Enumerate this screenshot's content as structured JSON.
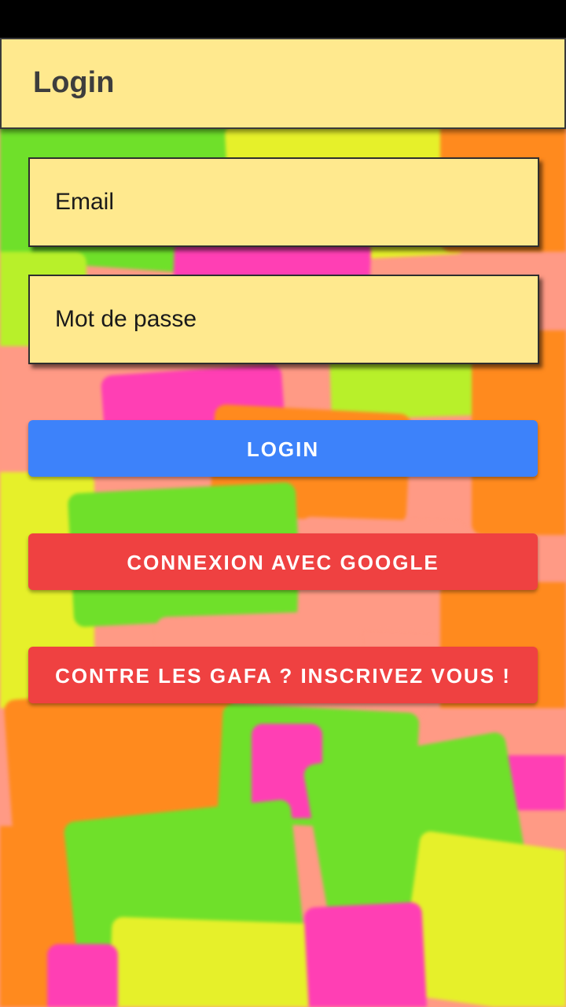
{
  "app_bar": {
    "title": "Login"
  },
  "form": {
    "email_placeholder": "Email",
    "password_placeholder": "Mot de passe"
  },
  "buttons": {
    "login": "LOGIN",
    "google": "CONNEXION AVEC GOOGLE",
    "register": "CONTRE LES GAFA ? INSCRIVEZ VOUS !"
  },
  "colors": {
    "app_bar_background": "#ffe98e",
    "field_background": "#ffe98e",
    "login_button": "#3d82fa",
    "google_button": "#ef4141",
    "register_button": "#ef4141",
    "status_bar": "#000000"
  },
  "background": {
    "description_icon": "sticky-notes-background",
    "colors": [
      "#6fe02a",
      "#e6f02a",
      "#ff8a1e",
      "#ff3fb4",
      "#ff9a85",
      "#b8f02a"
    ]
  }
}
